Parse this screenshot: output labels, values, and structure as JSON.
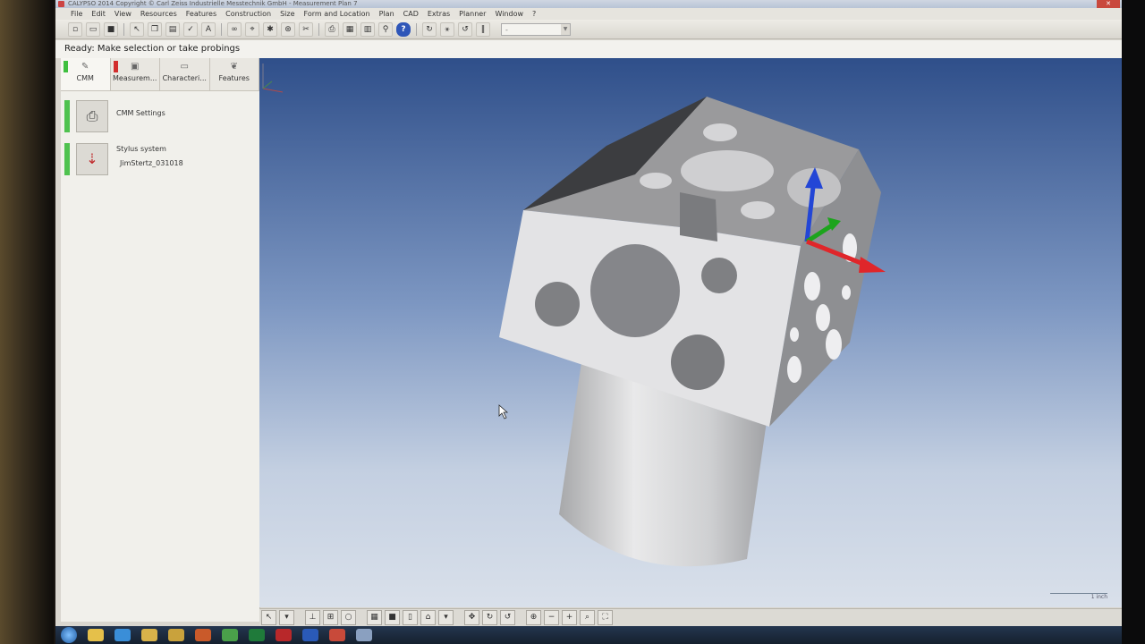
{
  "window": {
    "title": "CALYPSO 2014 Copyright © Carl Zeiss Industrielle Messtechnik GmbH - Measurement Plan 7"
  },
  "menu": [
    "File",
    "Edit",
    "View",
    "Resources",
    "Features",
    "Construction",
    "Size",
    "Form and Location",
    "Plan",
    "CAD",
    "Extras",
    "Planner",
    "Window",
    "?"
  ],
  "toolbar": {
    "icons": [
      "new-icon",
      "open-icon",
      "save-icon",
      "pointer-icon",
      "copy-icon",
      "paste-icon",
      "check-icon",
      "font-icon",
      "binoculars-icon",
      "probe-icon",
      "probe-settings-icon",
      "probe-ring-icon",
      "tools-icon",
      "print-icon",
      "print-preview-icon",
      "report-icon",
      "stylus-icon",
      "help-icon",
      "rotate-icon",
      "axis-icon",
      "reset-icon",
      "pause-icon"
    ],
    "combo_value": "-"
  },
  "status": "Ready: Make selection or take probings",
  "sidebar": {
    "tabs": [
      {
        "label": "CMM",
        "flag": "#3fbf3f"
      },
      {
        "label": "Measurem...",
        "flag": "#d22d2d"
      },
      {
        "label": "Characteri...",
        "flag": ""
      },
      {
        "label": "Features",
        "flag": ""
      }
    ],
    "items": [
      {
        "title": "CMM Settings",
        "sub": ""
      },
      {
        "title": "Stylus system",
        "sub": "JimStertz_031018"
      }
    ]
  },
  "viewport": {
    "scale_label": "1 inch",
    "axis_colors": {
      "x": "#e0262a",
      "y": "#1ca41c",
      "z": "#2346d6"
    }
  }
}
